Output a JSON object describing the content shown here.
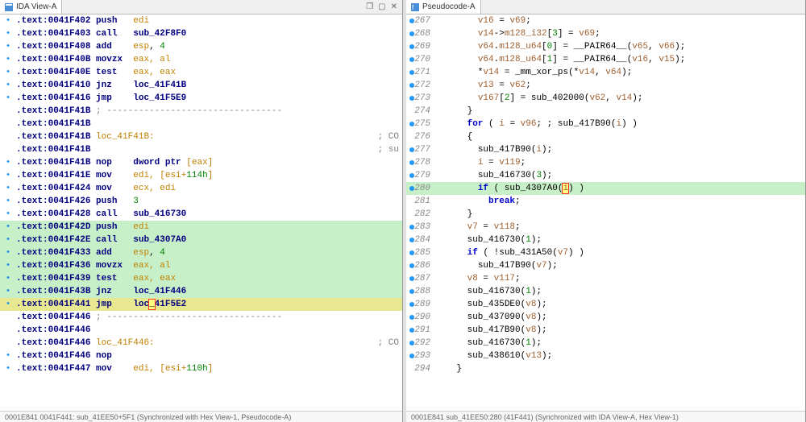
{
  "left": {
    "tab": "IDA View-A",
    "lines": [
      {
        "g": "•",
        "addr": ".text:0041F402",
        "mn": "push",
        "ops": "edi"
      },
      {
        "g": "•",
        "addr": ".text:0041F403",
        "mn": "call",
        "ops": "sub_42F8F0",
        "call": true
      },
      {
        "g": "•",
        "addr": ".text:0041F408",
        "mn": "add",
        "ops": "esp, 4",
        "imm": true
      },
      {
        "g": "•",
        "addr": ".text:0041F40B",
        "mn": "movzx",
        "ops": "eax, al"
      },
      {
        "g": "•",
        "addr": ".text:0041F40E",
        "mn": "test",
        "ops": "eax, eax"
      },
      {
        "g": "•",
        "addr": ".text:0041F410",
        "mn": "jnz",
        "ops": "loc_41F41B",
        "call": true
      },
      {
        "g": "•",
        "addr": ".text:0041F416",
        "mn": "jmp",
        "ops": "loc_41F5E9",
        "call": true
      },
      {
        "g": "",
        "addr": ".text:0041F41B",
        "mn": ";",
        "ops": "---------------------------------",
        "cmt": true
      },
      {
        "g": "",
        "addr": ".text:0041F41B",
        "mn": "",
        "ops": ""
      },
      {
        "g": "",
        "addr": ".text:0041F41B",
        "mn": "loc_41F41B:",
        "ops": "",
        "tail": "; CO",
        "lblline": true
      },
      {
        "g": "",
        "addr": ".text:0041F41B",
        "mn": "",
        "ops": "",
        "tail": "; su"
      },
      {
        "g": "•",
        "addr": ".text:0041F41B",
        "mn": "nop",
        "ops": "dword ptr [eax]",
        "ptr": true
      },
      {
        "g": "•",
        "addr": ".text:0041F41E",
        "mn": "mov",
        "ops": "edi, [esi+114h]",
        "ptr": true
      },
      {
        "g": "•",
        "addr": ".text:0041F424",
        "mn": "mov",
        "ops": "ecx, edi"
      },
      {
        "g": "•",
        "addr": ".text:0041F426",
        "mn": "push",
        "ops": "3",
        "imm": true
      },
      {
        "g": "•",
        "addr": ".text:0041F428",
        "mn": "call",
        "ops": "sub_416730",
        "call": true
      },
      {
        "g": "•",
        "addr": ".text:0041F42D",
        "mn": "push",
        "ops": "edi",
        "hl": "g"
      },
      {
        "g": "•",
        "addr": ".text:0041F42E",
        "mn": "call",
        "ops": "sub_4307A0",
        "call": true,
        "hl": "g"
      },
      {
        "g": "•",
        "addr": ".text:0041F433",
        "mn": "add",
        "ops": "esp, 4",
        "imm": true,
        "hl": "g"
      },
      {
        "g": "•",
        "addr": ".text:0041F436",
        "mn": "movzx",
        "ops": "eax, al",
        "hl": "g"
      },
      {
        "g": "•",
        "addr": ".text:0041F439",
        "mn": "test",
        "ops": "eax, eax",
        "hl": "g"
      },
      {
        "g": "•",
        "addr": ".text:0041F43B",
        "mn": "jnz",
        "ops": "loc_41F446",
        "call": true,
        "hl": "g"
      },
      {
        "g": "•",
        "addr": ".text:0041F441",
        "mn": "jmp",
        "ops": "loc_41F5E2",
        "call": true,
        "hl": "y",
        "caret": true
      },
      {
        "g": "",
        "addr": ".text:0041F446",
        "mn": ";",
        "ops": "---------------------------------",
        "cmt": true
      },
      {
        "g": "",
        "addr": ".text:0041F446",
        "mn": "",
        "ops": ""
      },
      {
        "g": "",
        "addr": ".text:0041F446",
        "mn": "loc_41F446:",
        "ops": "",
        "tail": "; CO",
        "lblline": true
      },
      {
        "g": "•",
        "addr": ".text:0041F446",
        "mn": "nop",
        "ops": ""
      },
      {
        "g": "•",
        "addr": ".text:0041F447",
        "mn": "mov",
        "ops": "edi, [esi+110h]",
        "ptr": true
      }
    ],
    "status": "0001E841 0041F441: sub_41EE50+5F1 (Synchronized with Hex View-1, Pseudocode-A)"
  },
  "right": {
    "tab": "Pseudocode-A",
    "lines": [
      {
        "n": 267,
        "d": true,
        "t": "        v16 = v69;"
      },
      {
        "n": 268,
        "d": true,
        "t": "        v14->m128_i32[3] = v69;"
      },
      {
        "n": 269,
        "d": true,
        "t": "        v64.m128_u64[0] = __PAIR64__(v65, v66);"
      },
      {
        "n": 270,
        "d": true,
        "t": "        v64.m128_u64[1] = __PAIR64__(v16, v15);"
      },
      {
        "n": 271,
        "d": true,
        "t": "        *v14 = _mm_xor_ps(*v14, v64);"
      },
      {
        "n": 272,
        "d": true,
        "t": "        v13 = v62;"
      },
      {
        "n": 273,
        "d": true,
        "t": "        v167[2] = sub_402000(v62, v14);"
      },
      {
        "n": 274,
        "d": false,
        "t": "      }"
      },
      {
        "n": 275,
        "d": true,
        "t": "      for ( i = v96; ; sub_417B90(i) )"
      },
      {
        "n": 276,
        "d": false,
        "t": "      {"
      },
      {
        "n": 277,
        "d": true,
        "t": "        sub_417B90(i);"
      },
      {
        "n": 278,
        "d": true,
        "t": "        i = v119;"
      },
      {
        "n": 279,
        "d": true,
        "t": "        sub_416730(3);"
      },
      {
        "n": 280,
        "d": true,
        "t": "        if ( sub_4307A0(i) )",
        "hl": "g",
        "caret": true
      },
      {
        "n": 281,
        "d": false,
        "t": "          break;"
      },
      {
        "n": 282,
        "d": false,
        "t": "      }"
      },
      {
        "n": 283,
        "d": true,
        "t": "      v7 = v118;"
      },
      {
        "n": 284,
        "d": true,
        "t": "      sub_416730(1);"
      },
      {
        "n": 285,
        "d": true,
        "t": "      if ( !sub_431A50(v7) )"
      },
      {
        "n": 286,
        "d": true,
        "t": "        sub_417B90(v7);"
      },
      {
        "n": 287,
        "d": true,
        "t": "      v8 = v117;"
      },
      {
        "n": 288,
        "d": true,
        "t": "      sub_416730(1);"
      },
      {
        "n": 289,
        "d": true,
        "t": "      sub_435DE0(v8);"
      },
      {
        "n": 290,
        "d": true,
        "t": "      sub_437090(v8);"
      },
      {
        "n": 291,
        "d": true,
        "t": "      sub_417B90(v8);"
      },
      {
        "n": 292,
        "d": true,
        "t": "      sub_416730(1);"
      },
      {
        "n": 293,
        "d": true,
        "t": "      sub_438610(v13);"
      },
      {
        "n": 294,
        "d": false,
        "t": "    }"
      }
    ],
    "status": "0001E841 sub_41EE50:280 (41F441) (Synchronized with IDA View-A, Hex View-1)"
  }
}
